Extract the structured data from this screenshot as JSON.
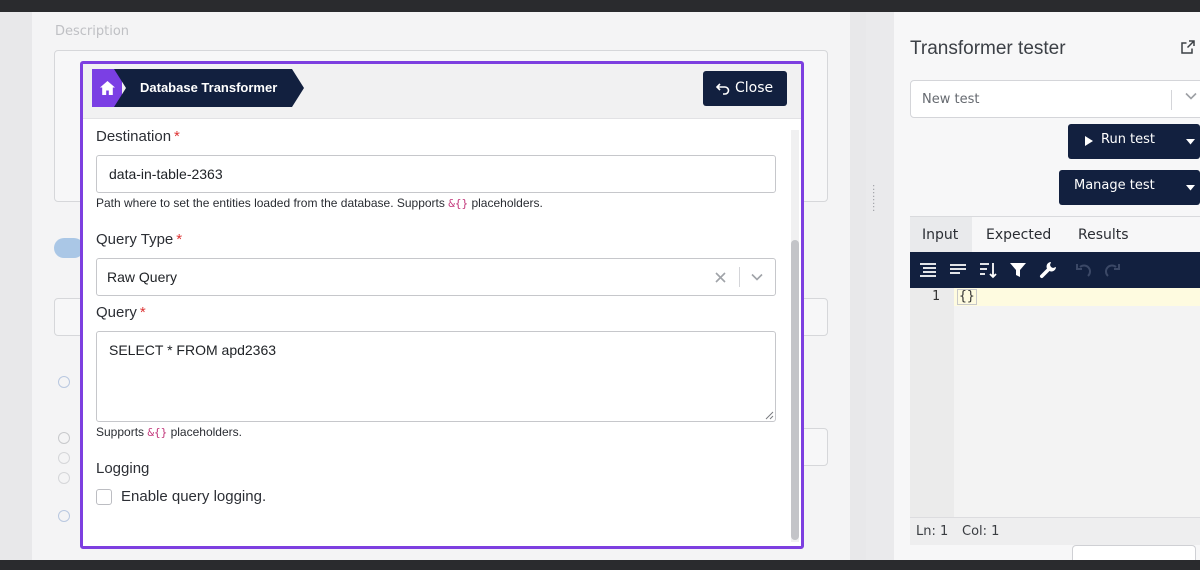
{
  "background": {
    "description_label": "Description"
  },
  "tester": {
    "title": "Transformer tester",
    "test_select": "New test",
    "run_test": "Run test",
    "manage_test": "Manage test",
    "tabs": [
      {
        "label": "Input",
        "active": true
      },
      {
        "label": "Expected",
        "active": false
      },
      {
        "label": "Results",
        "active": false
      }
    ],
    "editor": {
      "line_number": "1",
      "content": "{}",
      "status_line": "Ln: 1",
      "status_col": "Col: 1"
    }
  },
  "modal": {
    "breadcrumb": "Database Transformer",
    "close_label": "Close",
    "destination": {
      "label": "Destination",
      "required": "*",
      "value": "data-in-table-2363",
      "help_before": "Path where to set the entities loaded from the database. Supports",
      "help_code": "&{}",
      "help_after": "placeholders."
    },
    "query_type": {
      "label": "Query Type",
      "required": "*",
      "value": "Raw Query"
    },
    "query": {
      "label": "Query",
      "required": "*",
      "value": "SELECT * FROM apd2363",
      "help_before": "Supports",
      "help_code": "&{}",
      "help_after": "placeholders."
    },
    "logging": {
      "label": "Logging",
      "checkbox_label": "Enable query logging.",
      "checked": false
    }
  },
  "colors": {
    "accent": "#7b3fe4",
    "dark_button": "#12203f",
    "required": "#dd3333",
    "code": "#c2367a"
  }
}
